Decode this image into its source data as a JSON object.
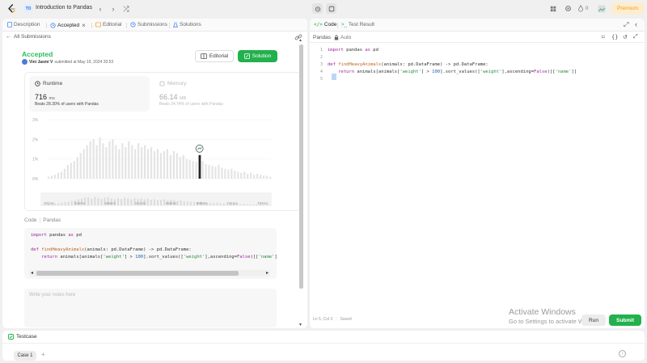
{
  "topnav": {
    "badge": "TO",
    "problem_title": "Introduction to Pandas",
    "prev_symbol": "‹",
    "next_symbol": "›",
    "shuffle_symbol": "⤮",
    "streak_count": "0",
    "premium_label": "Premium"
  },
  "left": {
    "tabs": [
      {
        "label": "Description"
      },
      {
        "label": "Accepted",
        "close": "×"
      },
      {
        "label": "Editorial"
      },
      {
        "label": "Submissions"
      },
      {
        "label": "Solutions"
      }
    ],
    "back_label": "All Submissions",
    "status": "Accepted",
    "user": "Vini Jasmi V",
    "submitted_text": "submitted at May 19, 2024 20:53",
    "editorial_btn": "Editorial",
    "solution_btn": "Solution",
    "runtime": {
      "label": "Runtime",
      "value": "716",
      "unit": "ms",
      "beats": "Beats 28.30% of users with Pandas"
    },
    "memory": {
      "label": "Memory",
      "value": "66.14",
      "unit": "MB",
      "beats": "Beats 24.74% of users with Pandas"
    },
    "code_tab": "Code",
    "code_lang": "Pandas",
    "notes_placeholder": "Write your notes here"
  },
  "chart_data": {
    "type": "bar",
    "ylabels": [
      "3%",
      "2%",
      "1%",
      "0%"
    ],
    "ylim": [
      0,
      3
    ],
    "x_ticks": [
      "482ms",
      "525ms",
      "568ms",
      "611ms",
      "655ms",
      "698ms",
      "741ms",
      "784ms"
    ],
    "values": [
      0.1,
      0.15,
      0.2,
      0.3,
      0.35,
      0.5,
      0.7,
      0.8,
      0.9,
      1.1,
      1.3,
      1.5,
      1.7,
      1.9,
      2.0,
      1.7,
      2.1,
      1.8,
      1.6,
      1.9,
      2.0,
      1.7,
      1.5,
      1.8,
      1.6,
      1.9,
      1.7,
      1.5,
      1.8,
      1.6,
      1.7,
      1.5,
      1.6,
      1.4,
      1.5,
      1.3,
      1.4,
      1.5,
      1.2,
      1.4,
      1.3,
      1.1,
      1.2,
      1.0,
      0.95,
      0.9,
      0.85,
      0.8,
      0.9,
      0.75,
      0.7,
      0.65,
      0.6,
      0.7,
      0.55,
      0.5,
      0.45,
      0.5,
      0.4,
      0.35,
      0.3,
      0.35,
      0.25,
      0.3,
      0.2,
      0.25,
      0.2,
      0.15,
      0.15,
      0.1
    ],
    "highlight_index": 47,
    "highlight_value": 1.2
  },
  "code_lines": [
    "import pandas as pd",
    "",
    "def findHeavyAnimals(animals: pd.DataFrame) -> pd.DataFrame:",
    "    return animals[animals['weight'] > 100].sort_values(['weight'],ascending=False)[['name']]",
    ""
  ],
  "right": {
    "code_tab": "Code",
    "test_tab": "Test Result",
    "lang": "Pandas",
    "auto": "Auto",
    "status": "Ln 5, Col 3",
    "saved": "Saved",
    "run_btn": "Run",
    "submit_btn": "Submit"
  },
  "windows": {
    "line1": "Activate Windows",
    "line2": "Go to Settings to activate Windows."
  },
  "testcase": {
    "title": "Testcase",
    "case1": "Case 1",
    "add": "+"
  }
}
